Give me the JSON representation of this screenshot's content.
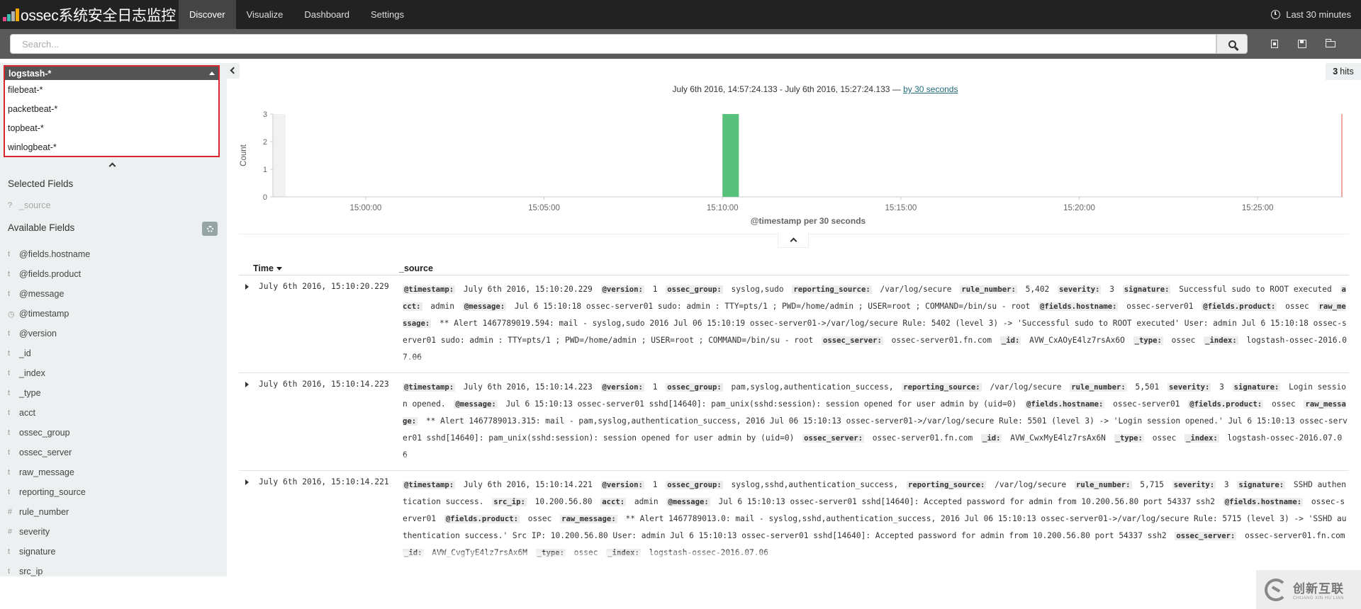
{
  "app": {
    "title": "ossec系统安全日志监控",
    "nav_tabs": [
      {
        "label": "Discover",
        "active": true
      },
      {
        "label": "Visualize",
        "active": false
      },
      {
        "label": "Dashboard",
        "active": false
      },
      {
        "label": "Settings",
        "active": false
      }
    ],
    "time_picker": "Last 30 minutes",
    "accent": "#222222"
  },
  "search": {
    "placeholder": "Search...",
    "value": ""
  },
  "sidebar": {
    "index_patterns": {
      "selected": "logstash-*",
      "options": [
        "filebeat-*",
        "packetbeat-*",
        "topbeat-*",
        "winlogbeat-*"
      ]
    },
    "selected_fields_title": "Selected Fields",
    "selected_fields": [
      {
        "type": "?",
        "name": "_source"
      }
    ],
    "available_fields_title": "Available Fields",
    "available_fields": [
      {
        "type": "t",
        "name": "@fields.hostname"
      },
      {
        "type": "t",
        "name": "@fields.product"
      },
      {
        "type": "t",
        "name": "@message"
      },
      {
        "type": "clock",
        "name": "@timestamp"
      },
      {
        "type": "t",
        "name": "@version"
      },
      {
        "type": "t",
        "name": "_id"
      },
      {
        "type": "t",
        "name": "_index"
      },
      {
        "type": "t",
        "name": "_type"
      },
      {
        "type": "t",
        "name": "acct"
      },
      {
        "type": "t",
        "name": "ossec_group"
      },
      {
        "type": "t",
        "name": "ossec_server"
      },
      {
        "type": "t",
        "name": "raw_message"
      },
      {
        "type": "t",
        "name": "reporting_source"
      },
      {
        "type": "#",
        "name": "rule_number"
      },
      {
        "type": "#",
        "name": "severity"
      },
      {
        "type": "t",
        "name": "signature"
      },
      {
        "type": "t",
        "name": "src_ip"
      }
    ]
  },
  "results": {
    "hits_count": "3",
    "hits_label": "hits",
    "time_range_text": "July 6th 2016, 14:57:24.133 - July 6th 2016, 15:27:24.133 — ",
    "interval_link": "by 30 seconds",
    "col_time": "Time",
    "col_source": "_source"
  },
  "chart_data": {
    "type": "bar",
    "ylabel": "Count",
    "xlabel": "@timestamp per 30 seconds",
    "ylim": [
      0,
      3
    ],
    "yticks": [
      "0",
      "1",
      "2",
      "3"
    ],
    "xticks": [
      "15:00:00",
      "15:05:00",
      "15:10:00",
      "15:15:00",
      "15:20:00",
      "15:25:00"
    ],
    "bars": [
      {
        "x": "15:10:00",
        "value": 3
      }
    ],
    "bar_color": "#57c17b",
    "grid": false
  },
  "documents": [
    {
      "time": "July 6th 2016, 15:10:20.229",
      "fields": [
        {
          "k": "@timestamp:",
          "v": "July 6th 2016, 15:10:20.229"
        },
        {
          "k": "@version:",
          "v": "1"
        },
        {
          "k": "ossec_group:",
          "v": "syslog,sudo"
        },
        {
          "k": "reporting_source:",
          "v": "/var/log/secure"
        },
        {
          "k": "rule_number:",
          "v": "5,402"
        },
        {
          "k": "severity:",
          "v": "3"
        },
        {
          "k": "signature:",
          "v": "Successful sudo to ROOT executed"
        },
        {
          "k": "acct:",
          "v": "admin"
        },
        {
          "k": "@message:",
          "v": "Jul 6 15:10:18 ossec-server01 sudo: admin : TTY=pts/1 ; PWD=/home/admin ; USER=root ; COMMAND=/bin/su - root"
        },
        {
          "k": "@fields.hostname:",
          "v": "ossec-server01"
        },
        {
          "k": "@fields.product:",
          "v": "ossec"
        },
        {
          "k": "raw_message:",
          "v": "** Alert 1467789019.594: mail - syslog,sudo 2016 Jul 06 15:10:19 ossec-server01->/var/log/secure Rule: 5402 (level 3) -> 'Successful sudo to ROOT executed' User: admin Jul 6 15:10:18 ossec-server01 sudo: admin : TTY=pts/1 ; PWD=/home/admin ; USER=root ; COMMAND=/bin/su - root"
        },
        {
          "k": "ossec_server:",
          "v": "ossec-server01.fn.com"
        },
        {
          "k": "_id:",
          "v": "AVW_CxAOyE4lz7rsAx6O"
        },
        {
          "k": "_type:",
          "v": "ossec"
        },
        {
          "k": "_index:",
          "v": "logstash-ossec-2016.07.06"
        }
      ]
    },
    {
      "time": "July 6th 2016, 15:10:14.223",
      "fields": [
        {
          "k": "@timestamp:",
          "v": "July 6th 2016, 15:10:14.223"
        },
        {
          "k": "@version:",
          "v": "1"
        },
        {
          "k": "ossec_group:",
          "v": "pam,syslog,authentication_success,"
        },
        {
          "k": "reporting_source:",
          "v": "/var/log/secure"
        },
        {
          "k": "rule_number:",
          "v": "5,501"
        },
        {
          "k": "severity:",
          "v": "3"
        },
        {
          "k": "signature:",
          "v": "Login session opened."
        },
        {
          "k": "@message:",
          "v": "Jul 6 15:10:13 ossec-server01 sshd[14640]: pam_unix(sshd:session): session opened for user admin by (uid=0)"
        },
        {
          "k": "@fields.hostname:",
          "v": "ossec-server01"
        },
        {
          "k": "@fields.product:",
          "v": "ossec"
        },
        {
          "k": "raw_message:",
          "v": "** Alert 1467789013.315: mail - pam,syslog,authentication_success, 2016 Jul 06 15:10:13 ossec-server01->/var/log/secure Rule: 5501 (level 3) -> 'Login session opened.' Jul 6 15:10:13 ossec-server01 sshd[14640]: pam_unix(sshd:session): session opened for user admin by (uid=0)"
        },
        {
          "k": "ossec_server:",
          "v": "ossec-server01.fn.com"
        },
        {
          "k": "_id:",
          "v": "AVW_CwxMyE4lz7rsAx6N"
        },
        {
          "k": "_type:",
          "v": "ossec"
        },
        {
          "k": "_index:",
          "v": "logstash-ossec-2016.07.06"
        }
      ]
    },
    {
      "time": "July 6th 2016, 15:10:14.221",
      "fields": [
        {
          "k": "@timestamp:",
          "v": "July 6th 2016, 15:10:14.221"
        },
        {
          "k": "@version:",
          "v": "1"
        },
        {
          "k": "ossec_group:",
          "v": "syslog,sshd,authentication_success,"
        },
        {
          "k": "reporting_source:",
          "v": "/var/log/secure"
        },
        {
          "k": "rule_number:",
          "v": "5,715"
        },
        {
          "k": "severity:",
          "v": "3"
        },
        {
          "k": "signature:",
          "v": "SSHD authentication success."
        },
        {
          "k": "src_ip:",
          "v": "10.200.56.80"
        },
        {
          "k": "acct:",
          "v": "admin"
        },
        {
          "k": "@message:",
          "v": "Jul 6 15:10:13 ossec-server01 sshd[14640]: Accepted password for admin from 10.200.56.80 port 54337 ssh2"
        },
        {
          "k": "@fields.hostname:",
          "v": "ossec-server01"
        },
        {
          "k": "@fields.product:",
          "v": "ossec"
        },
        {
          "k": "raw_message:",
          "v": "** Alert 1467789013.0: mail - syslog,sshd,authentication_success, 2016 Jul 06 15:10:13 ossec-server01->/var/log/secure Rule: 5715 (level 3) -> 'SSHD authentication success.' Src IP: 10.200.56.80 User: admin Jul 6 15:10:13 ossec-server01 sshd[14640]: Accepted password for admin from 10.200.56.80 port 54337 ssh2"
        },
        {
          "k": "ossec_server:",
          "v": "ossec-server01.fn.com"
        },
        {
          "k": "_id:",
          "v": "AVW_CvgTyE4lz7rsAx6M"
        },
        {
          "k": "_type:",
          "v": "ossec"
        },
        {
          "k": "_index:",
          "v": "logstash-ossec-2016.07.06"
        }
      ]
    }
  ],
  "watermark": {
    "text": "创新互联",
    "sub": "CHUANG XIN HU LIAN"
  }
}
